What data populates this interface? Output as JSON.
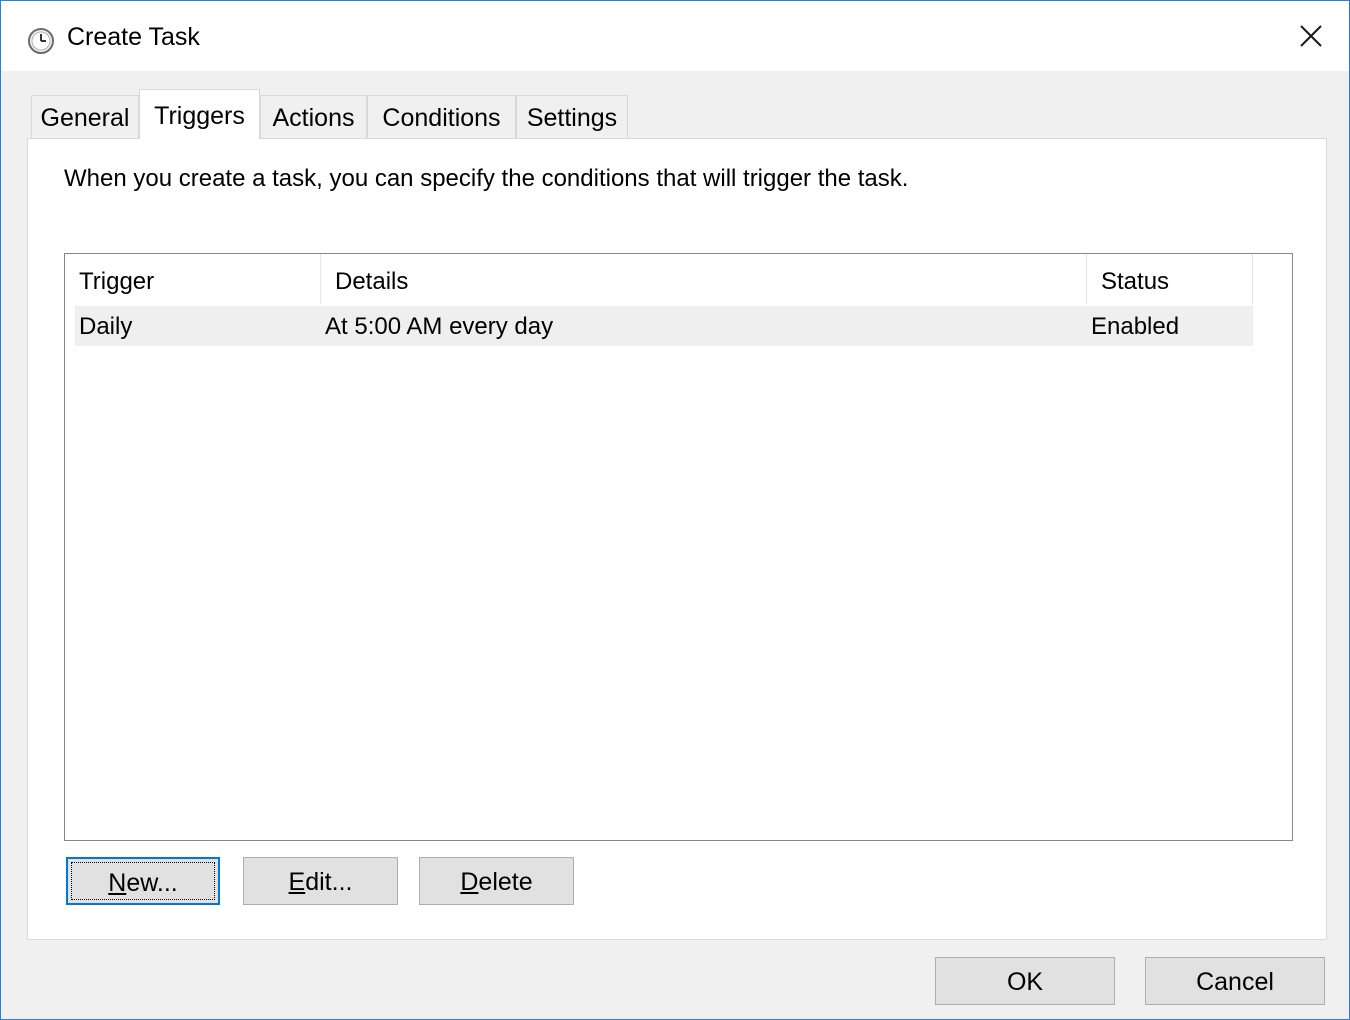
{
  "window": {
    "title": "Create Task",
    "icons": {
      "app": "clock-icon",
      "close": "close-icon"
    },
    "accent_color": "#0078d7"
  },
  "tabs": [
    {
      "label": "General",
      "active": false
    },
    {
      "label": "Triggers",
      "active": true
    },
    {
      "label": "Actions",
      "active": false
    },
    {
      "label": "Conditions",
      "active": false
    },
    {
      "label": "Settings",
      "active": false
    }
  ],
  "triggers": {
    "description": "When you create a task, you can specify the conditions that will trigger the task.",
    "columns": [
      "Trigger",
      "Details",
      "Status"
    ],
    "rows": [
      {
        "trigger": "Daily",
        "details": "At 5:00 AM every day",
        "status": "Enabled"
      }
    ],
    "buttons": {
      "new": {
        "mnemonic": "N",
        "rest": "ew..."
      },
      "edit": {
        "mnemonic": "E",
        "rest": "dit..."
      },
      "delete": {
        "mnemonic": "D",
        "rest": "elete"
      }
    }
  },
  "footer": {
    "ok": "OK",
    "cancel": "Cancel"
  }
}
